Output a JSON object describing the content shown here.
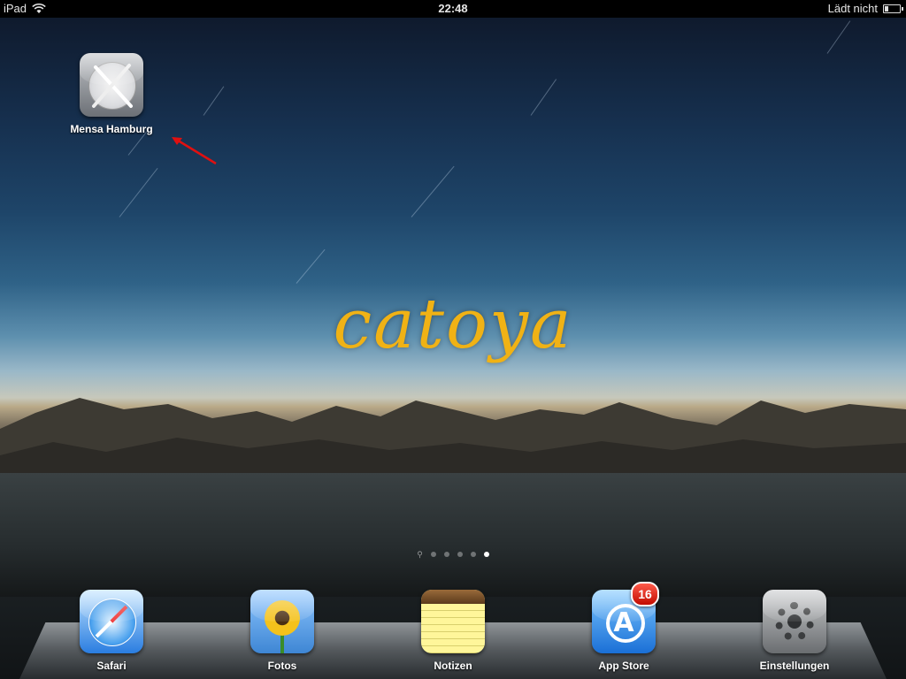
{
  "status_bar": {
    "device": "iPad",
    "time": "22:48",
    "charging_status": "Lädt nicht",
    "battery_level_fraction": 0.25
  },
  "wallpaper": {
    "brand_text": "catoya",
    "brand_color": "#f0b215"
  },
  "home_apps": [
    {
      "label": "Mensa Hamburg",
      "icon": "plate-cutlery-icon"
    }
  ],
  "annotation": {
    "arrow_color": "#e01010"
  },
  "page_indicator": {
    "pages": 5,
    "active_page": 5,
    "has_search_page": true
  },
  "dock": [
    {
      "label": "Safari",
      "icon": "compass-icon"
    },
    {
      "label": "Fotos",
      "icon": "sunflower-icon"
    },
    {
      "label": "Notizen",
      "icon": "notepad-icon"
    },
    {
      "label": "App Store",
      "icon": "app-store-icon",
      "badge": "16"
    },
    {
      "label": "Einstellungen",
      "icon": "gear-icon"
    }
  ]
}
